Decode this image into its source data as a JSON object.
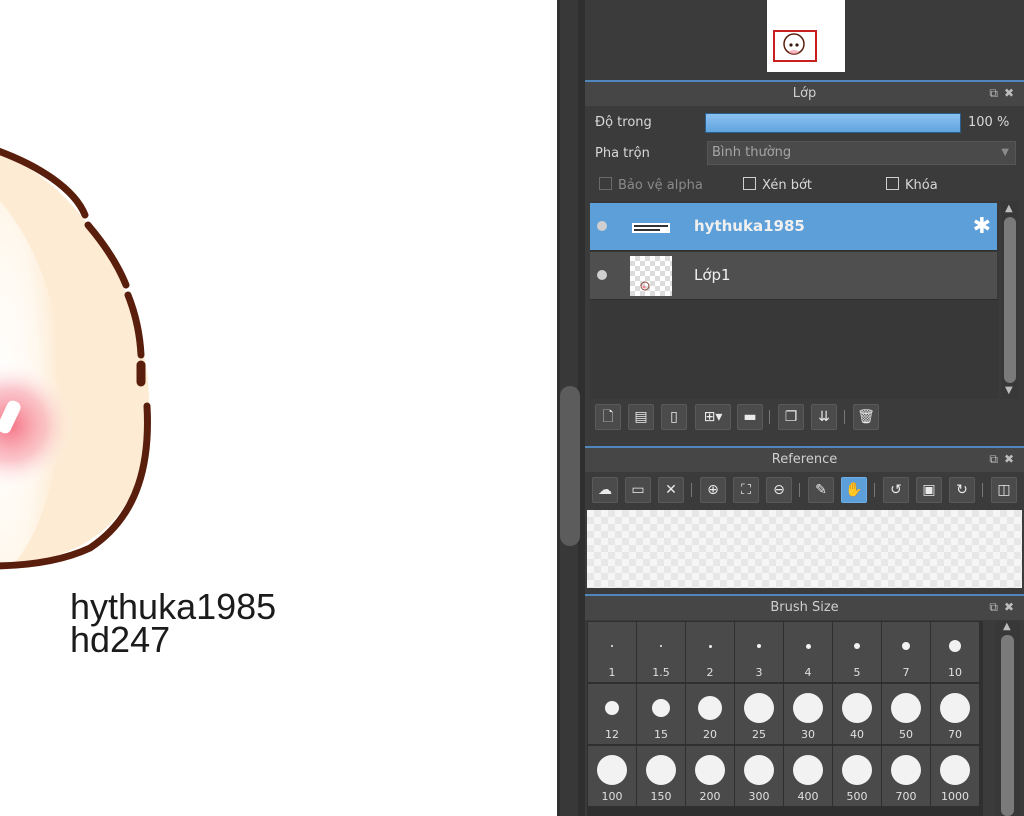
{
  "canvas": {
    "caption_line1": "hythuka1985",
    "caption_line2": "hd247"
  },
  "layer_panel": {
    "title": "Lớp",
    "opacity_label": "Độ trong",
    "opacity_value": "100 %",
    "opacity_fraction": 1.0,
    "blend_label": "Pha trộn",
    "blend_value": "Bình thường",
    "protect_alpha_label": "Bảo vệ alpha",
    "clipping_label": "Xén bớt",
    "lock_label": "Khóa",
    "layers": [
      {
        "name": "hythuka1985",
        "selected": true
      },
      {
        "name": "Lớp1",
        "selected": false
      }
    ]
  },
  "reference_panel": {
    "title": "Reference"
  },
  "brush_panel": {
    "title": "Brush Size",
    "sizes": [
      "1",
      "1.5",
      "2",
      "3",
      "4",
      "5",
      "7",
      "10",
      "12",
      "15",
      "20",
      "25",
      "30",
      "40",
      "50",
      "70",
      "100",
      "150",
      "200",
      "300",
      "400",
      "500",
      "700",
      "1000"
    ]
  },
  "colors": {
    "accent": "#5d9fd8",
    "panel_bg": "#3b3b3b",
    "outline_brown": "#5a1f0c",
    "skin": "#fdebd3",
    "blush": "#f56b7e"
  }
}
